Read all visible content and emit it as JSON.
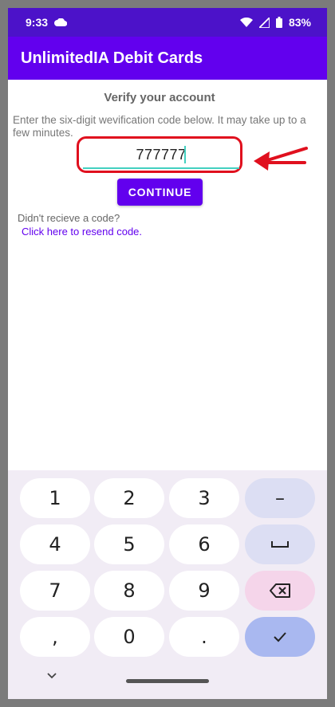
{
  "status_bar": {
    "time": "9:33",
    "battery": "83%"
  },
  "app_bar": {
    "title": "UnlimitedIA Debit Cards"
  },
  "verify": {
    "title": "Verify your account",
    "instructions": "Enter the six-digit wevification code below. It may take up to a few minutes.",
    "code_value": "777777",
    "continue_label": "CONTINUE",
    "no_code_text": "Didn't recieve a code?",
    "resend_link": "Click here to resend code."
  },
  "keyboard": {
    "rows": [
      [
        "1",
        "2",
        "3",
        "–"
      ],
      [
        "4",
        "5",
        "6",
        "␣"
      ],
      [
        "7",
        "8",
        "9",
        "⌫"
      ],
      [
        ",",
        "0",
        ".",
        "✓"
      ]
    ]
  },
  "colors": {
    "status_bar": "#4c12c9",
    "app_bar": "#6200ee",
    "highlight": "#e0101e",
    "input_underline": "#43d0c0"
  }
}
